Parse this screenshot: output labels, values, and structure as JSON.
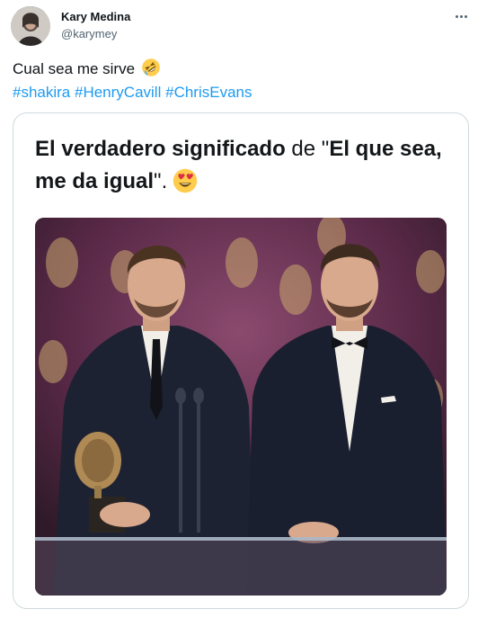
{
  "user": {
    "display_name": "Kary Medina",
    "handle": "@karymey",
    "avatar_icon": "profile-photo-avatar"
  },
  "tweet": {
    "text": "Cual sea me sirve",
    "text_emoji": "rolling-on-floor-laughing-emoji",
    "hashtags": [
      "#shakira",
      "#HenryCavill",
      "#ChrisEvans"
    ]
  },
  "menu": {
    "icon": "more-dots-icon"
  },
  "meme": {
    "caption_bold_1": "El verdadero significado",
    "caption_normal_1": " de \"",
    "caption_bold_2": "El que sea, me da igual",
    "caption_normal_2": "\".",
    "caption_emoji": "heart-eyes-emoji",
    "photo_description_icon": "award-ceremony-photo"
  },
  "colors": {
    "link": "#1d9bf0",
    "text": "#0f1419",
    "secondary": "#536471",
    "border": "#cfd9de"
  }
}
